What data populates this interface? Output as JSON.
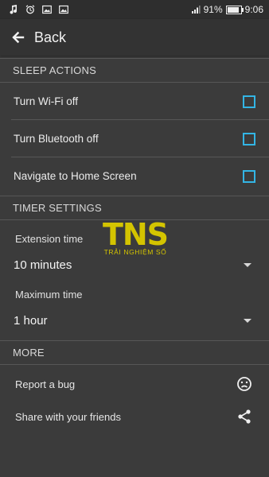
{
  "status_bar": {
    "icons": [
      "music-note-icon",
      "alarm-icon",
      "image-icon",
      "image-icon"
    ],
    "battery_percent": "91%",
    "battery_level": 0.91,
    "time": "9:06"
  },
  "app_bar": {
    "back_icon": "arrow-left-icon",
    "back_label": "Back"
  },
  "sleep_actions": {
    "header": "SLEEP ACTIONS",
    "items": [
      {
        "label": "Turn Wi-Fi off",
        "checked": false
      },
      {
        "label": "Turn Bluetooth off",
        "checked": false
      },
      {
        "label": "Navigate to Home Screen",
        "checked": false
      }
    ]
  },
  "timer_settings": {
    "header": "TIMER SETTINGS",
    "extension": {
      "label": "Extension time",
      "value": "10 minutes"
    },
    "maximum": {
      "label": "Maximum time",
      "value": "1 hour"
    }
  },
  "more": {
    "header": "MORE",
    "items": [
      {
        "label": "Report a bug",
        "icon": "sad-face-icon"
      },
      {
        "label": "Share with your friends",
        "icon": "share-icon"
      }
    ]
  },
  "watermark": {
    "logo": "TNS",
    "subtitle": "TRẢI NGHIỆM SỐ"
  },
  "colors": {
    "background": "#3b3b3b",
    "app_bar": "#333333",
    "checkbox_accent": "#33b5e5",
    "watermark": "#d4c400"
  }
}
